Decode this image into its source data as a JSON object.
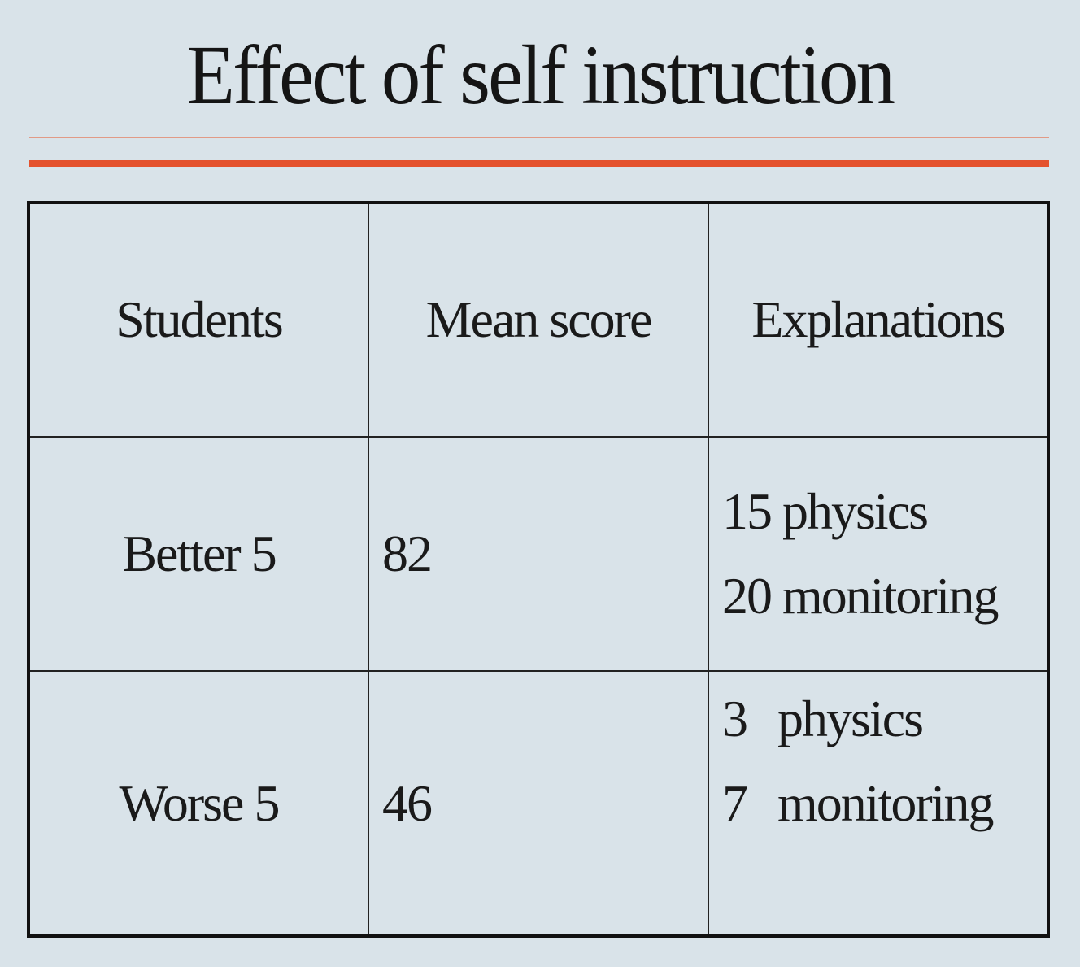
{
  "slide": {
    "title": "Effect of self instruction"
  },
  "table": {
    "headers": [
      "Students",
      "Mean score",
      "Explanations"
    ],
    "rows": [
      {
        "students": "Better 5",
        "mean_score": "82",
        "explanations": [
          {
            "count": "15",
            "label": "physics"
          },
          {
            "count": "20",
            "label": "monitoring"
          }
        ]
      },
      {
        "students": "Worse 5",
        "mean_score": "46",
        "explanations": [
          {
            "count": "3",
            "label": "physics"
          },
          {
            "count": "7",
            "label": "monitoring"
          }
        ]
      }
    ]
  },
  "colors": {
    "background": "#d9e3e9",
    "accent_rule": "#e4522e",
    "text": "#1a1a1a"
  }
}
